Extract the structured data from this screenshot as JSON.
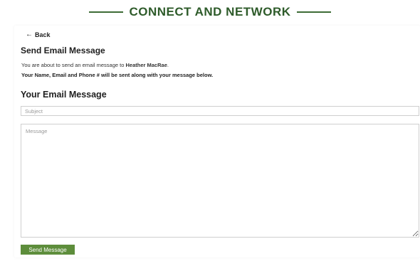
{
  "header": {
    "title": "CONNECT AND NETWORK"
  },
  "nav": {
    "back_label": "Back",
    "back_icon": "arrow-left-icon"
  },
  "form": {
    "heading": "Send Email Message",
    "intro_prefix": "You are about to send an email message to ",
    "recipient": "Heather MacRae",
    "intro_suffix": ".",
    "note": "Your Name, Email and Phone # will be sent along with your message below.",
    "section_heading": "Your Email Message",
    "subject_placeholder": "Subject",
    "subject_value": "",
    "message_placeholder": "Message",
    "message_value": "",
    "send_label": "Send Message"
  },
  "colors": {
    "brand_green": "#2e5b2a",
    "button_green": "#5d8d3b",
    "border": "#cfcfcf"
  }
}
